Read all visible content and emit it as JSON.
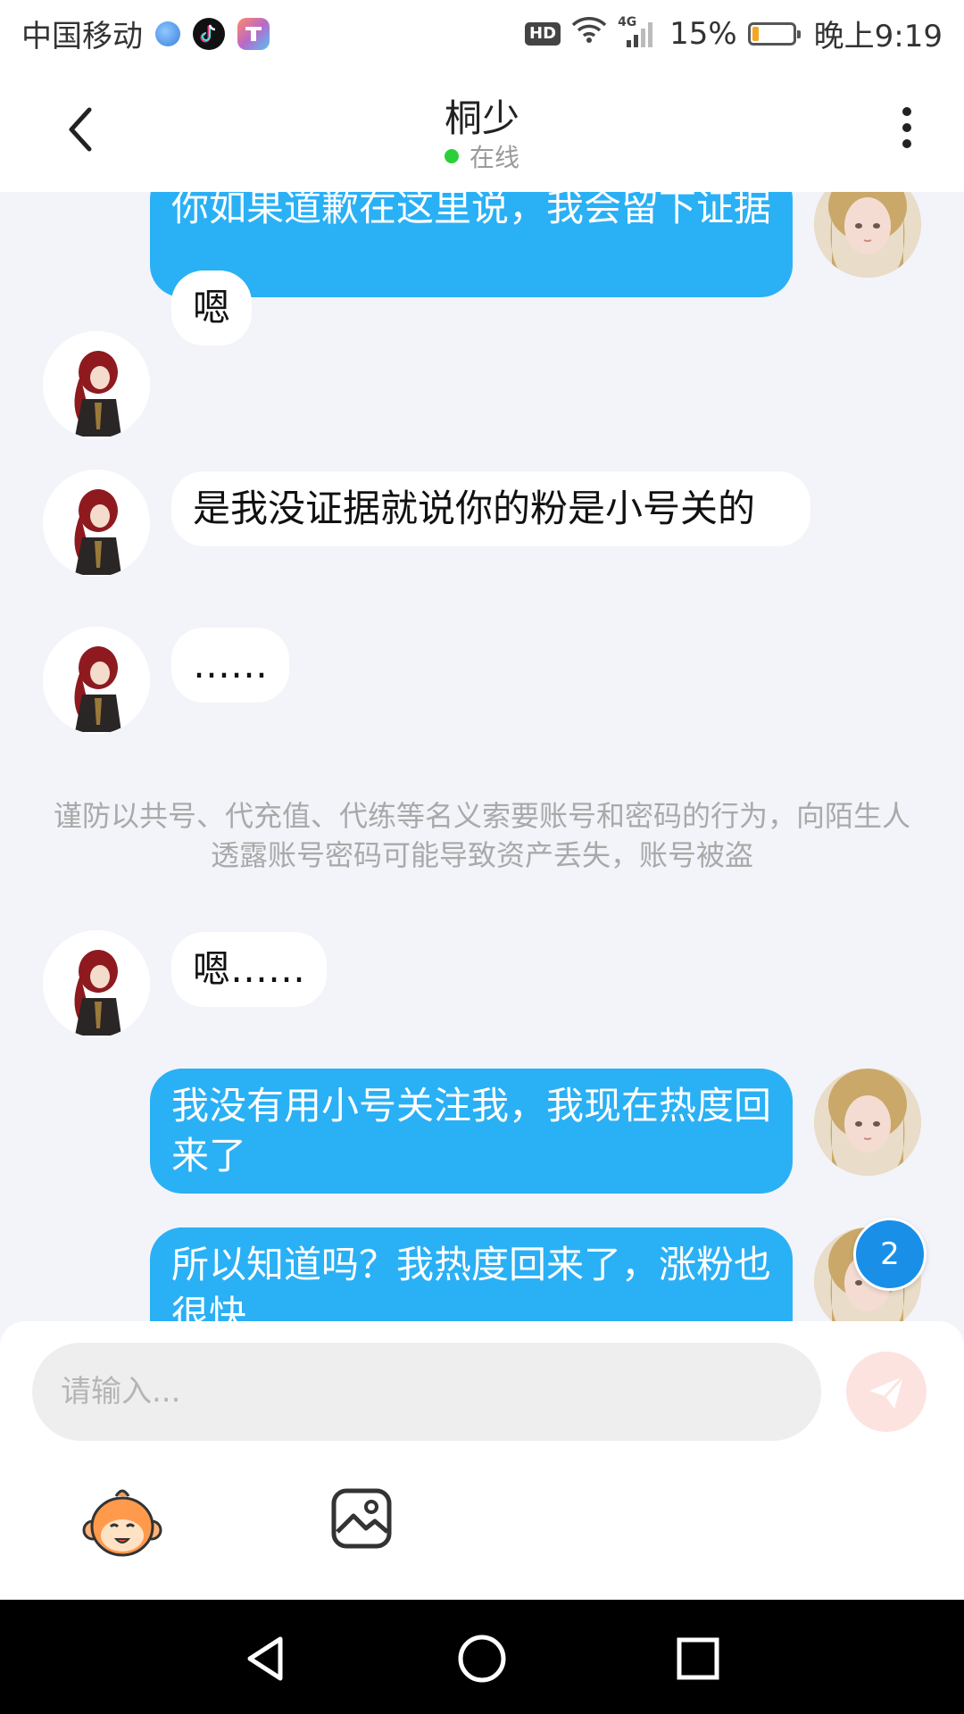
{
  "status_bar": {
    "carrier": "中国移动",
    "network": "4G",
    "battery_level": 0.15,
    "battery_text": "15%",
    "time": "晚上9:19",
    "hd_label": "HD",
    "app_icons": [
      "browser-icon",
      "tiktok-icon",
      "tasks-app-icon"
    ]
  },
  "header": {
    "back_icon": "chevron-left-icon",
    "title": "桐少",
    "status": "在线",
    "status_color": "#2ccf3a",
    "more_icon": "more-vertical-icon"
  },
  "messages": [
    {
      "from": "me",
      "text": "你如果道歉在这里说，我会留下证据"
    },
    {
      "from": "other",
      "text": "嗯"
    },
    {
      "from": "other",
      "text": "是我没证据就说你的粉是小号关的"
    },
    {
      "from": "other",
      "text": "……"
    },
    {
      "type": "notice",
      "text": "谨防以共号、代充值、代练等名义索要账号和密码的行为，向陌生人透露账号密码可能导致资产丢失，账号被盗"
    },
    {
      "from": "other",
      "text": "嗯……"
    },
    {
      "from": "me",
      "text": "我没有用小号关注我，我现在热度回来了"
    },
    {
      "from": "me",
      "text": "所以知道吗？我热度回来了，涨粉也很快"
    }
  ],
  "unread_count": "2",
  "input": {
    "placeholder": "请输入...",
    "value": ""
  },
  "toolbar": {
    "emoji_icon": "monkey-emoji-icon",
    "image_icon": "image-icon",
    "send_icon": "send-icon"
  },
  "colors": {
    "my_bubble": "#2ab0f5",
    "other_bubble": "#ffffff",
    "background": "#f2f4f9",
    "unread_badge": "#1a8fe8"
  },
  "nav_bar": [
    "back-triangle-icon",
    "home-circle-icon",
    "recents-square-icon"
  ]
}
